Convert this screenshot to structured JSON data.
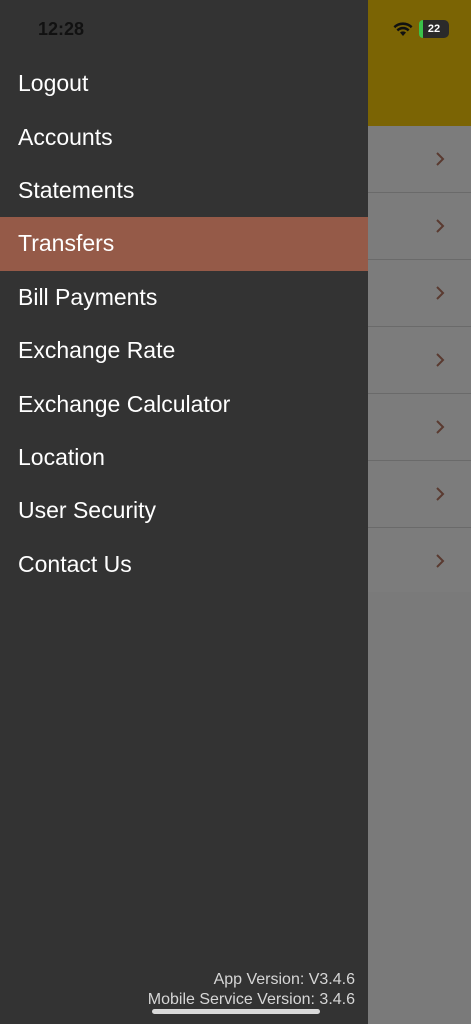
{
  "status_bar": {
    "time": "12:28",
    "battery": "22"
  },
  "drawer": {
    "menu": [
      {
        "label": "Logout",
        "active": false
      },
      {
        "label": "Accounts",
        "active": false
      },
      {
        "label": "Statements",
        "active": false
      },
      {
        "label": "Transfers",
        "active": true
      },
      {
        "label": "Bill Payments",
        "active": false
      },
      {
        "label": "Exchange Rate",
        "active": false
      },
      {
        "label": "Exchange Calculator",
        "active": false
      },
      {
        "label": "Location",
        "active": false
      },
      {
        "label": "User Security",
        "active": false
      },
      {
        "label": "Contact Us",
        "active": false
      }
    ],
    "app_version": "App Version: V3.4.6",
    "service_version": "Mobile Service Version: 3.4.6"
  },
  "colors": {
    "drawer_bg": "#333333",
    "active_item": "#955a48",
    "header_accent": "#7b6404"
  }
}
